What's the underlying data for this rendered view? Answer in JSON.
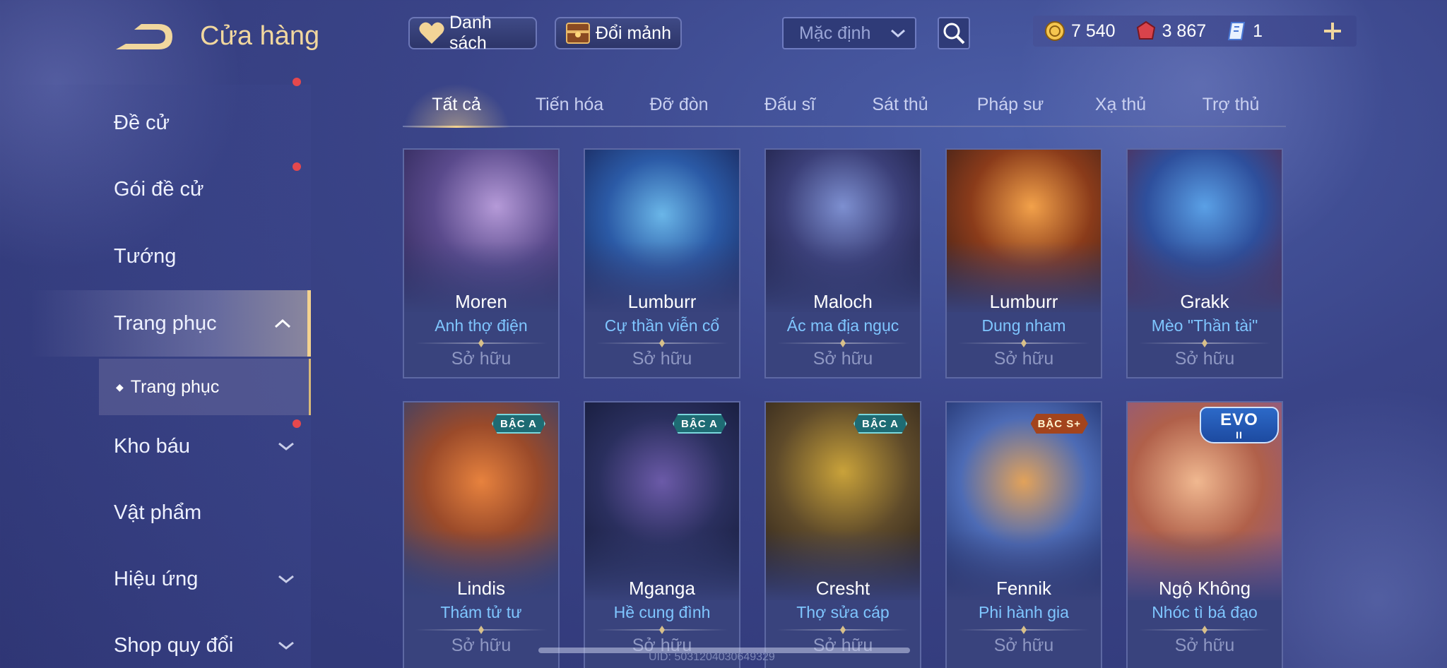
{
  "header": {
    "title": "Cửa hàng",
    "list_label": "Danh sách",
    "trade_label": "Đổi mảnh",
    "sort": {
      "selected": "Mặc định"
    }
  },
  "currency": [
    {
      "icon": "gold-coin-icon",
      "value": "7 540"
    },
    {
      "icon": "red-gem-icon",
      "value": "3 867"
    },
    {
      "icon": "ticket-icon",
      "value": "1"
    }
  ],
  "sidebar": {
    "items": [
      {
        "label": "Đề cử"
      },
      {
        "label": "Gói đề cử"
      },
      {
        "label": "Tướng"
      },
      {
        "label": "Trang phục"
      },
      {
        "label": "Kho báu"
      },
      {
        "label": "Vật phẩm"
      },
      {
        "label": "Hiệu ứng"
      },
      {
        "label": "Shop quy đổi"
      }
    ],
    "sub_item": "Trang phục"
  },
  "tabs": [
    "Tất cả",
    "Tiến hóa",
    "Đỡ đòn",
    "Đấu sĩ",
    "Sát thủ",
    "Pháp sư",
    "Xạ thủ",
    "Trợ thủ"
  ],
  "cards": [
    {
      "hero": "Moren",
      "skin": "Anh thợ điện",
      "status": "Sở hữu",
      "badge": ""
    },
    {
      "hero": "Lumburr",
      "skin": "Cự thần viễn cổ",
      "status": "Sở hữu",
      "badge": ""
    },
    {
      "hero": "Maloch",
      "skin": "Ác ma địa ngục",
      "status": "Sở hữu",
      "badge": ""
    },
    {
      "hero": "Lumburr",
      "skin": "Dung nham",
      "status": "Sở hữu",
      "badge": ""
    },
    {
      "hero": "Grakk",
      "skin": "Mèo \"Thần tài\"",
      "status": "Sở hữu",
      "badge": ""
    },
    {
      "hero": "Lindis",
      "skin": "Thám tử tư",
      "status": "Sở hữu",
      "badge": "BẬC A"
    },
    {
      "hero": "Mganga",
      "skin": "Hề cung đình",
      "status": "Sở hữu",
      "badge": "BẬC A"
    },
    {
      "hero": "Cresht",
      "skin": "Thợ sửa cáp",
      "status": "Sở hữu",
      "badge": "BẬC A"
    },
    {
      "hero": "Fennik",
      "skin": "Phi hành gia",
      "status": "Sở hữu",
      "badge": "BẬC S+"
    },
    {
      "hero": "Ngộ Không",
      "skin": "Nhóc tì bá đạo",
      "status": "Sở hữu",
      "badge": "EVO",
      "badge_sub": "II"
    }
  ],
  "footer": {
    "uid": "UID: 5031204030649329"
  },
  "colors": {
    "accent": "#f3d28f",
    "skin_name": "#7fc6ff",
    "background": "#3a4488"
  }
}
